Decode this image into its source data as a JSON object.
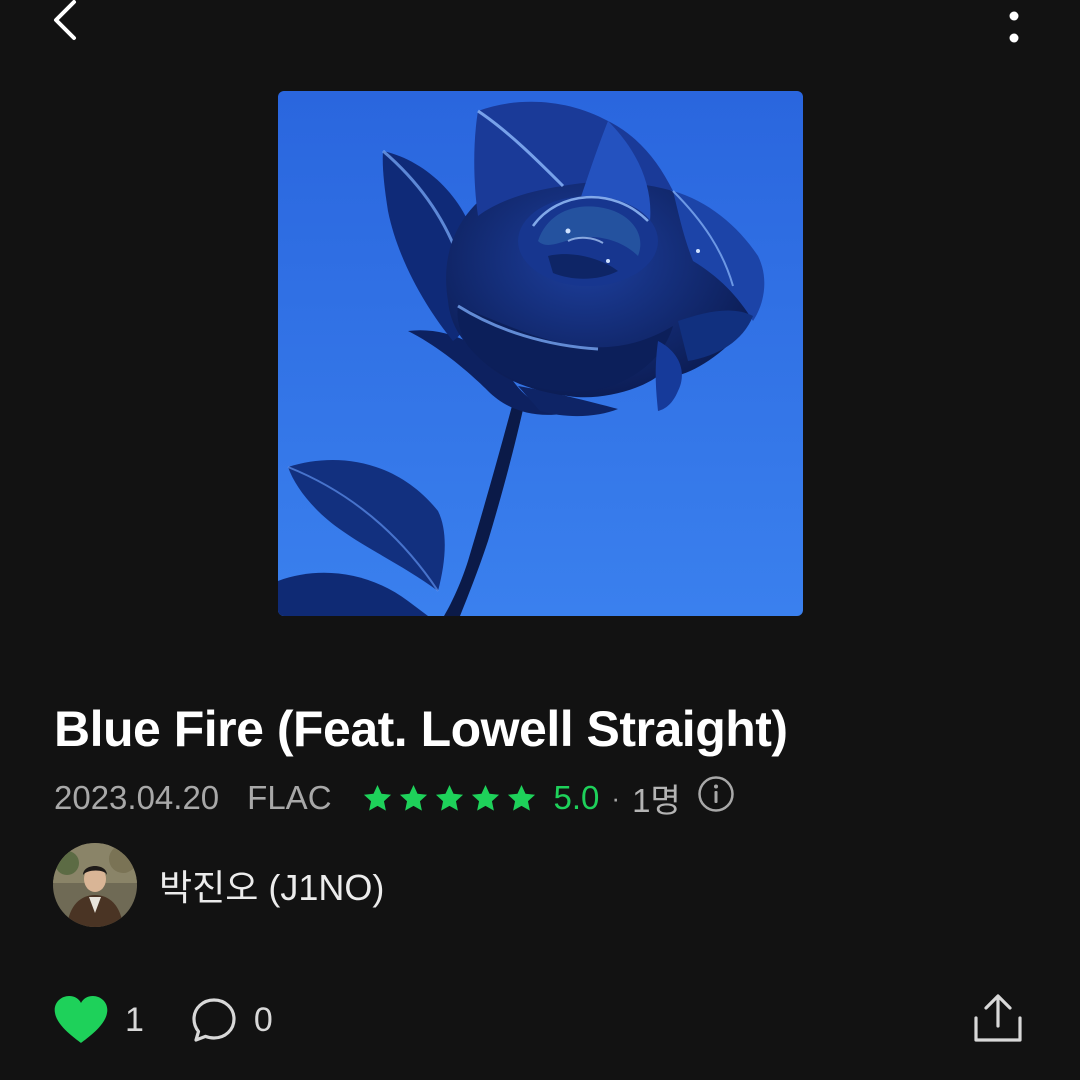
{
  "header": {
    "back_icon": "chevron-left-icon",
    "more_icon": "vertical-dots-icon"
  },
  "album_art": {
    "subject": "blue rose illustration",
    "background_color": "#2f6be0"
  },
  "song": {
    "title": "Blue Fire (Feat. Lowell Straight)",
    "release_date": "2023.04.20",
    "format": "FLAC",
    "rating": {
      "stars": 5,
      "max_stars": 5,
      "value": "5.0",
      "separator": "·",
      "raters": "1명",
      "star_color": "#1ed15a"
    }
  },
  "artist": {
    "name": "박진오 (J1NO)"
  },
  "actions": {
    "like_count": "1",
    "comment_count": "0",
    "like_color": "#1ed15a"
  }
}
